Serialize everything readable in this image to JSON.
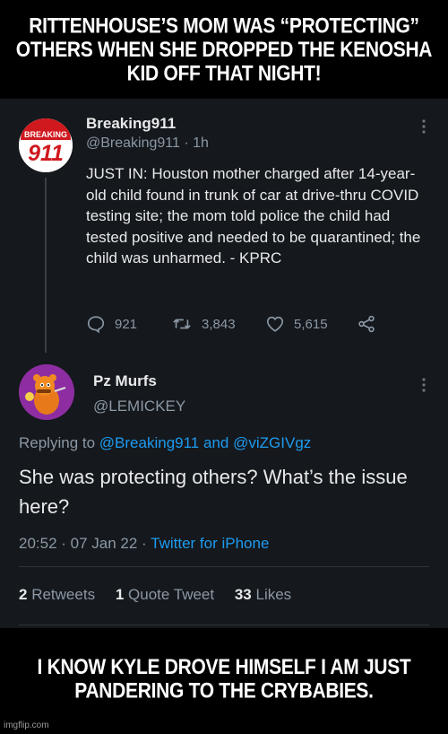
{
  "meme": {
    "top_text": "RITTENHOUSE’S MOM WAS “PROTECTING” OTHERS WHEN SHE DROPPED THE KENOSHA KID OFF THAT NIGHT!",
    "bottom_text": "I KNOW KYLE DROVE HIMSELF I AM JUST PANDERING TO THE CRYBABIES.",
    "watermark": "imgflip.com"
  },
  "tweet1": {
    "avatar_text_top": "BREAKING",
    "avatar_text_big": "911",
    "name": "Breaking911",
    "handle": "@Breaking911",
    "time": "· 1h",
    "body": "JUST IN: Houston mother charged after 14-year-old child found in trunk of car at drive-thru COVID testing site; the mom told police the child had tested positive and needed to be quarantined; the child was unharmed. - KPRC",
    "replies": "921",
    "retweets": "3,843",
    "likes": "5,615"
  },
  "tweet2": {
    "name": "Pz Murfs",
    "handle": "@LEMICKEY",
    "replying_prefix": "Replying to",
    "replying_user1": "@Breaking911",
    "replying_and": "and",
    "replying_user2": "@viZGIVgz",
    "body": "She was protecting others? What’s the issue here?",
    "time": "20:52 · 07 Jan 22 ·",
    "client": "Twitter for iPhone",
    "retweets_count": "2",
    "retweets_label": "Retweets",
    "quotes_count": "1",
    "quotes_label": "Quote Tweet",
    "likes_count": "33",
    "likes_label": "Likes"
  },
  "colors": {
    "background": "#15181c",
    "link": "#1d9bf0",
    "muted": "#8b98a5",
    "avatar_red": "#d0181f"
  }
}
